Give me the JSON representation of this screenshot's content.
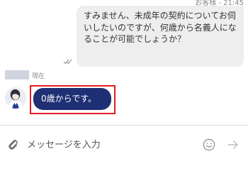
{
  "chat": {
    "outgoing": {
      "sender_time": "お客様 - 21:45",
      "text": "すみません、未成年の契約についてお伺いしたいのですが、何歳から名義人になることが可能でしょうか？"
    },
    "incoming": {
      "time": "現在",
      "text": "0歳からです。"
    }
  },
  "composer": {
    "placeholder": "メッセージを入力"
  },
  "icons": {
    "read_receipt": "double-check-icon",
    "avatar": "agent-avatar-icon",
    "attach": "paperclip-icon",
    "emoji": "smiley-icon",
    "send": "arrow-right-icon"
  },
  "colors": {
    "incoming_bubble": "#1f2f73",
    "outgoing_bubble": "#eeeeee",
    "highlight_border": "#e11d26",
    "muted_text": "#8a8a8a"
  }
}
